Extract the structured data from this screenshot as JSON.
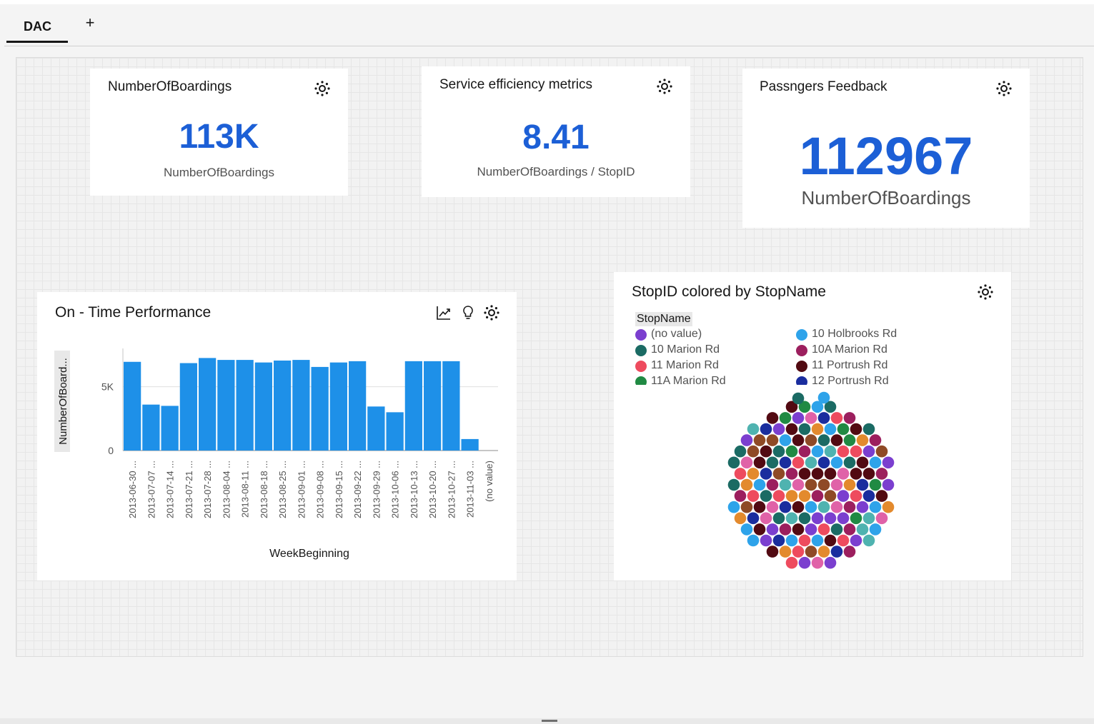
{
  "tabs": [
    {
      "label": "DAC",
      "active": true
    }
  ],
  "add_tab_label": "+",
  "kpi_cards": [
    {
      "title": "NumberOfBoardings",
      "value": "113K",
      "label": "NumberOfBoardings"
    },
    {
      "title": "Service efficiency metrics",
      "value": "8.41",
      "label": "NumberOfBoardings / StopID"
    },
    {
      "title": "Passngers Feedback",
      "value": "112967",
      "label": "NumberOfBoardings"
    }
  ],
  "bar_card": {
    "title": "On - Time Performance"
  },
  "pack_card": {
    "title": "StopID colored by StopName"
  },
  "colors": {
    "accent": "#1c5fd6",
    "bar": "#1e90e8"
  },
  "chart_data": [
    {
      "type": "bar",
      "title": "On - Time Performance",
      "xlabel": "WeekBeginning",
      "ylabel": "NumberOfBoard...",
      "ylim": [
        0,
        8000
      ],
      "yticks": [
        {
          "v": 0,
          "label": "0"
        },
        {
          "v": 5000,
          "label": "5K"
        }
      ],
      "grid": true,
      "categories": [
        "2013-06-30 ...",
        "2013-07-07 ...",
        "2013-07-14 ...",
        "2013-07-21 ...",
        "2013-07-28 ...",
        "2013-08-04 ...",
        "2013-08-11 ...",
        "2013-08-18 ...",
        "2013-08-25 ...",
        "2013-09-01 ...",
        "2013-09-08 ...",
        "2013-09-15 ...",
        "2013-09-22 ...",
        "2013-09-29 ...",
        "2013-10-06 ...",
        "2013-10-13 ...",
        "2013-10-20 ...",
        "2013-10-27 ...",
        "2013-11-03 ...",
        "(no value)"
      ],
      "values": [
        6950,
        3600,
        3500,
        6850,
        7250,
        7100,
        7100,
        6900,
        7050,
        7100,
        6550,
        6900,
        7000,
        3450,
        3000,
        7000,
        7000,
        7000,
        900,
        0
      ]
    },
    {
      "type": "scatter",
      "title": "StopID colored by StopName",
      "legend_title": "StopName",
      "legend": [
        {
          "name": "(no value)",
          "color": "#7b3fcf"
        },
        {
          "name": "10 Holbrooks Rd",
          "color": "#2ea3ea"
        },
        {
          "name": "10 Marion Rd",
          "color": "#1b6b64"
        },
        {
          "name": "10A Marion Rd",
          "color": "#9c1f5e"
        },
        {
          "name": "11 Marion Rd",
          "color": "#ee4b5e"
        },
        {
          "name": "11 Portrush Rd",
          "color": "#520a12"
        },
        {
          "name": "11A Marion Rd",
          "color": "#208a43"
        },
        {
          "name": "12 Portrush Rd",
          "color": "#1a2d9e"
        }
      ],
      "palette": [
        "#7b3fcf",
        "#2ea3ea",
        "#1b6b64",
        "#9c1f5e",
        "#ee4b5e",
        "#520a12",
        "#208a43",
        "#1a2d9e",
        "#e38a2d",
        "#4fb3b0",
        "#e062a8",
        "#8f4a26"
      ]
    }
  ]
}
